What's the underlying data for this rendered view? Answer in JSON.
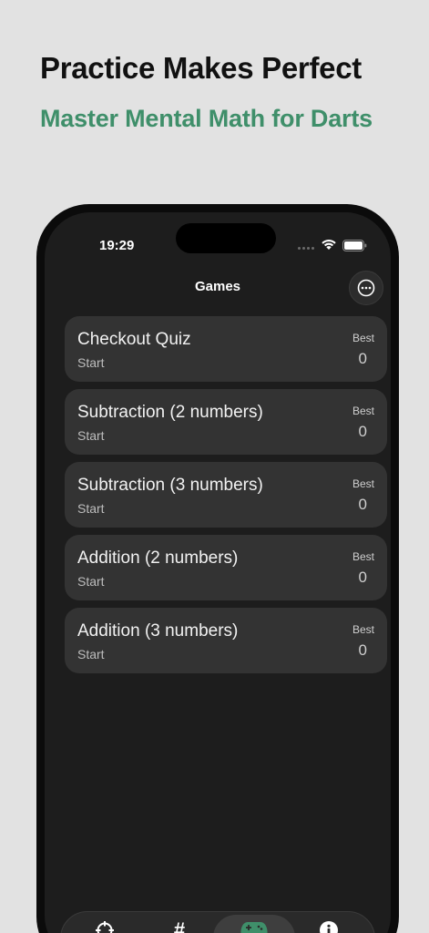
{
  "promo": {
    "headline": "Practice Makes Perfect",
    "subheadline": "Master Mental Math for Darts",
    "accent_color": "#3f8f6a"
  },
  "status_bar": {
    "time": "19:29"
  },
  "nav": {
    "title": "Games",
    "more_icon": "ellipsis-circle-icon"
  },
  "games": [
    {
      "title": "Checkout Quiz",
      "action": "Start",
      "best_label": "Best",
      "best_value": "0"
    },
    {
      "title": "Subtraction (2 numbers)",
      "action": "Start",
      "best_label": "Best",
      "best_value": "0"
    },
    {
      "title": "Subtraction (3 numbers)",
      "action": "Start",
      "best_label": "Best",
      "best_value": "0"
    },
    {
      "title": "Addition (2 numbers)",
      "action": "Start",
      "best_label": "Best",
      "best_value": "0"
    },
    {
      "title": "Addition (3 numbers)",
      "action": "Start",
      "best_label": "Best",
      "best_value": "0"
    }
  ],
  "tabs": [
    {
      "icon": "crosshair-icon",
      "glyph": ""
    },
    {
      "icon": "hash-icon",
      "glyph": "#"
    },
    {
      "icon": "gamecontroller-icon",
      "glyph": "",
      "active": true
    },
    {
      "icon": "info-icon",
      "glyph": ""
    }
  ]
}
